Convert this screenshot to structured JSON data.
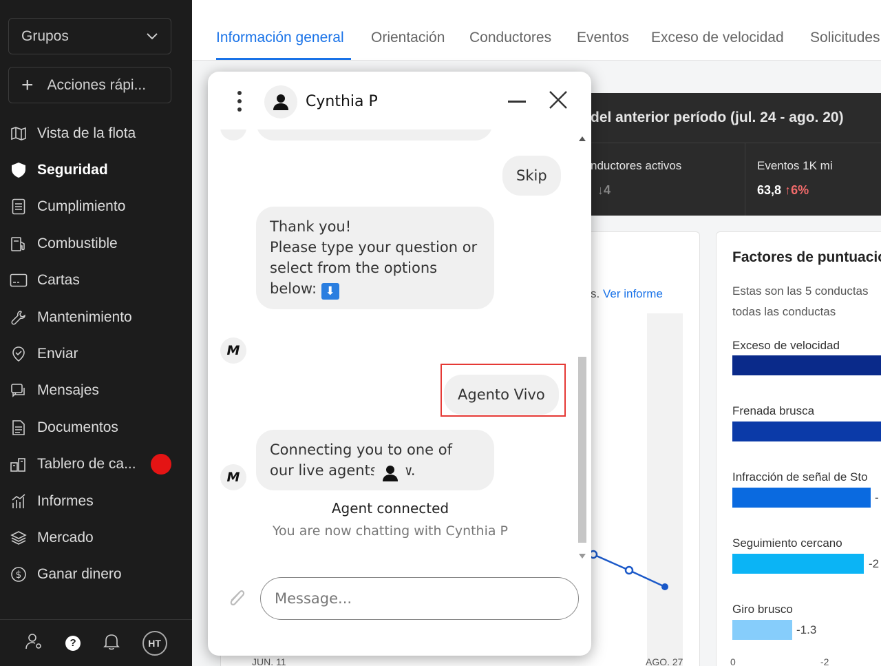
{
  "sidebar": {
    "groups_label": "Grupos",
    "quick_actions_label": "Acciones rápi...",
    "items": [
      {
        "label": "Vista de la flota",
        "icon": "map-icon"
      },
      {
        "label": "Seguridad",
        "icon": "shield-icon",
        "active": true
      },
      {
        "label": "Cumplimiento",
        "icon": "list-icon"
      },
      {
        "label": "Combustible",
        "icon": "fuel-icon"
      },
      {
        "label": "Cartas",
        "icon": "card-icon"
      },
      {
        "label": "Mantenimiento",
        "icon": "wrench-icon"
      },
      {
        "label": "Enviar",
        "icon": "dispatch-icon"
      },
      {
        "label": "Mensajes",
        "icon": "messages-icon"
      },
      {
        "label": "Documentos",
        "icon": "document-icon"
      },
      {
        "label": "Tablero de ca...",
        "icon": "dashboard-icon",
        "badge_color": "#e41414"
      },
      {
        "label": "Informes",
        "icon": "reports-icon"
      },
      {
        "label": "Mercado",
        "icon": "marketplace-icon"
      },
      {
        "label": "Ganar dinero",
        "icon": "dollar-icon"
      }
    ],
    "bottom": {
      "help": "?",
      "avatar": "HT"
    }
  },
  "tabs": [
    "Información general",
    "Orientación",
    "Conductores",
    "Eventos",
    "Exceso de velocidad",
    "Solicitudes"
  ],
  "summary": {
    "title": "del anterior período (jul. 24 - ago. 20)",
    "kpi1_label": "nductores activos",
    "kpi1_change": "↓4",
    "kpi2_label": "Eventos 1K mi",
    "kpi2_value": "63,8",
    "kpi2_change": "↑6%"
  },
  "left_card": {
    "link_prefix": "s.",
    "link_text": "Ver informe",
    "x_tick_start": "JUN. 11",
    "x_tick_end": "AGO. 27"
  },
  "factors": {
    "title": "Factores de puntuación",
    "desc": "Estas son las 5 conductas",
    "link": "todas las conductas",
    "items": [
      {
        "label": "Exceso de velocidad",
        "value": "",
        "color": "#0a2a8a"
      },
      {
        "label": "Frenada brusca",
        "value": "",
        "color": "#0b3aa8"
      },
      {
        "label": "Infracción de señal de Sto",
        "value": "-",
        "color": "#0a6ae0"
      },
      {
        "label": "Seguimiento cercano",
        "value": "-2",
        "color": "#0bb4f5"
      },
      {
        "label": "Giro brusco",
        "value": "-1.3",
        "color": "#86cdfb"
      }
    ],
    "axis_ticks": [
      "0",
      "-2"
    ]
  },
  "chat": {
    "agent_name": "Cynthia P",
    "messages": {
      "skip": "Skip",
      "thanks_1": "Thank you!",
      "thanks_2": "Please type your question or",
      "thanks_3": "select from the options",
      "thanks_4": "below:",
      "thanks_emoji": "⬇",
      "agent_vivo": "Agento Vivo",
      "connecting_1": "Connecting you to one of",
      "connecting_2": "our live agents now.",
      "bot_logo": "M"
    },
    "system": {
      "title": "Agent connected",
      "subtitle": "You are now chatting with Cynthia P"
    },
    "input_placeholder": "Message..."
  }
}
